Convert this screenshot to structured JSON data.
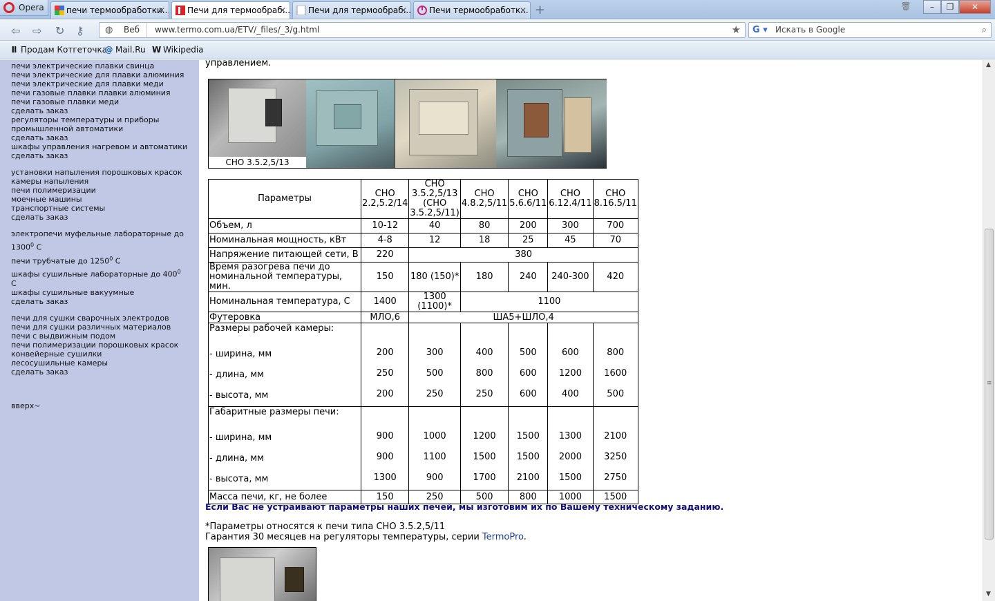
{
  "browser": {
    "menu_label": "Opera",
    "tabs": [
      {
        "title": "печи термообработки...",
        "active": false
      },
      {
        "title": "Печи для термообраб...",
        "active": true
      },
      {
        "title": "Печи для термообраб...",
        "active": false
      },
      {
        "title": "Печи термообработк...",
        "active": false
      }
    ],
    "new_tab_label": "+",
    "window_controls": [
      "–",
      "❐",
      "✕"
    ],
    "address": {
      "scope_label": "Веб",
      "url": "www.termo.com.ua/ETV/_files/_3/g.html"
    },
    "search": {
      "placeholder": "Искать в Google"
    },
    "bookmarks": [
      "Продам Котгеточка",
      "Mail.Ru",
      "Wikipedia"
    ]
  },
  "sidebar": {
    "links_top": [
      "печи электрические плавки свинца",
      "печи электрические для плавки алюминия",
      "печи электрические для плавки меди",
      "печи газовые плавки плавки алюминия",
      "печи газовые плавки меди",
      "сделать заказ",
      "регуляторы температуры и приборы",
      "промышленной автоматики",
      "сделать заказ",
      "шкафы управления нагревом и автоматики",
      "сделать заказ"
    ],
    "links_mid": [
      "установки напыления порошковых красок",
      "камеры напыления",
      "печи полимеризации",
      "моечные машины",
      "транспортные системы",
      "сделать заказ"
    ],
    "lab_1a": "электропечи муфельные лабораторные до",
    "lab_1b": "1300",
    "lab_2": "печи трубчатые до 1250",
    "lab_3a": "шкафы сушильные лабораторные до 400",
    "lab_3b": "С",
    "lab_4": "шкафы сушильные вакуумные",
    "lab_5": "сделать заказ",
    "degree": "0",
    "celsius": " С",
    "links_bottom": [
      "печи для сушки сварочных электродов",
      "печи для сушки различных материалов",
      "печи с выдвижным подом",
      "печи полимеризации порошковых красок",
      "конвейерные сушилки",
      "лесосушильные камеры",
      "сделать заказ"
    ],
    "up_link": "вверх~"
  },
  "content": {
    "top_text": "управлением.",
    "photo_caption": "СНО 3.5.2,5/13",
    "table": {
      "header_param": "Параметры",
      "headers": [
        [
          "СНО",
          "2.2,5.2/14"
        ],
        [
          "СНО",
          "3.5.2,5/13",
          "(СНО",
          "3.5.2,5/11)"
        ],
        [
          "СНО",
          "4.8.2,5/11"
        ],
        [
          "СНО",
          "5.6.6/11"
        ],
        [
          "СНО",
          "6.12.4/11"
        ],
        [
          "СНО",
          "8.16.5/11"
        ]
      ],
      "volume": {
        "label": "Объем, л",
        "values": [
          "10-12",
          "40",
          "80",
          "200",
          "300",
          "700"
        ]
      },
      "power": {
        "label": "Номинальная мощность, кВт",
        "values": [
          "4-8",
          "12",
          "18",
          "25",
          "45",
          "70"
        ]
      },
      "voltage": {
        "label": "Напряжение питающей сети, В",
        "v1": "220",
        "v2": "380"
      },
      "heat": {
        "label1": "Время разогрева печи до",
        "label2": "номинальной температуры, мин.",
        "values": [
          "150",
          "180 (150)*",
          "180",
          "240",
          "240-300",
          "420"
        ]
      },
      "temp": {
        "label": "Номинальная температура, С",
        "v1": "1400",
        "v2a": "1300",
        "v2b": "(1100)*",
        "v3": "1100"
      },
      "lining": {
        "label": "Футеровка",
        "v1": "МЛО,6",
        "v2": "ША5+ШЛО,4"
      },
      "chamber": {
        "label": "Размеры рабочей камеры:",
        "width_label": "- ширина, мм",
        "width": [
          "200",
          "300",
          "400",
          "500",
          "600",
          "800"
        ],
        "length_label": "- длина, мм",
        "length": [
          "250",
          "500",
          "800",
          "600",
          "1200",
          "1600"
        ],
        "height_label": "- высота, мм",
        "height": [
          "200",
          "250",
          "250",
          "600",
          "400",
          "500"
        ]
      },
      "overall": {
        "label": "Габаритные размеры печи:",
        "width_label": "- ширина, мм",
        "width": [
          "900",
          "1000",
          "1200",
          "1500",
          "1300",
          "2100"
        ],
        "length_label": "- длина, мм",
        "length": [
          "900",
          "1100",
          "1500",
          "1500",
          "2000",
          "3250"
        ],
        "height_label": "- высота, мм",
        "height": [
          "1300",
          "900",
          "1700",
          "2100",
          "1500",
          "2750"
        ]
      },
      "mass": {
        "label": "Масса печи, кг, не более",
        "values": [
          "150",
          "250",
          "500",
          "800",
          "1000",
          "1500"
        ]
      }
    },
    "bold_note": "Если Вас не устраивают параметры наших печей, мы изготовим их по Вашему техническому заданию.",
    "note1": "*Параметры относятся к печи типа СНО 3.5.2,5/11",
    "note2_text": "Гарантия 30 месяцев на регуляторы температуры, серии ",
    "note2_link": "TermoPro",
    "note2_end": "."
  }
}
